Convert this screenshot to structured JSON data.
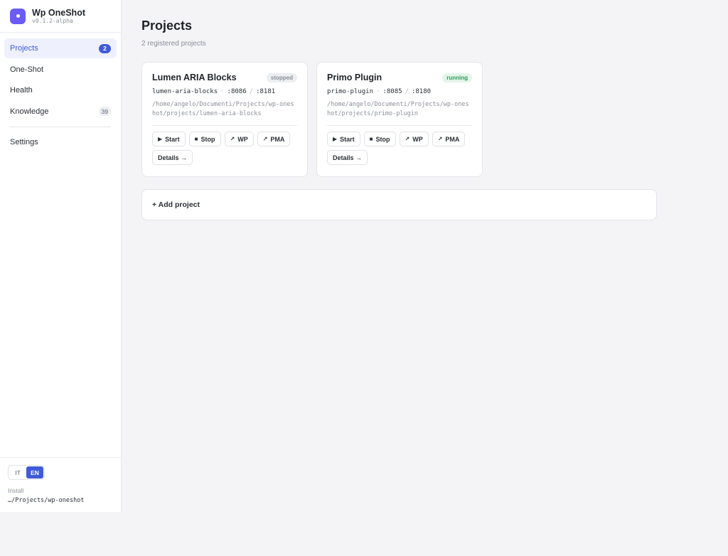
{
  "brand": {
    "name": "Wp OneShot",
    "version": "v0.1.2-alpha"
  },
  "nav": {
    "items": [
      {
        "label": "Projects",
        "badge": "2"
      },
      {
        "label": "One-Shot"
      },
      {
        "label": "Health"
      },
      {
        "label": "Knowledge",
        "badge": "39"
      }
    ],
    "settings_label": "Settings"
  },
  "footer": {
    "lang": [
      "IT",
      "EN"
    ],
    "active_lang": "EN",
    "install_label": "Install",
    "install_path": "…/Projects/wp-oneshot"
  },
  "main": {
    "title": "Projects",
    "subtitle": "2 registered projects",
    "add_project_label": "+ Add project"
  },
  "projects": [
    {
      "name": "Lumen ARIA Blocks",
      "status": "stopped",
      "slug": "lumen-aria-blocks",
      "port_wp": ":8086",
      "port_pma": ":8181",
      "path": "/home/angelo/Documenti/Projects/wp-oneshot/projects/lumen-aria-blocks"
    },
    {
      "name": "Primo Plugin",
      "status": "running",
      "slug": "primo-plugin",
      "port_wp": ":8085",
      "port_pma": ":8180",
      "path": "/home/angelo/Documenti/Projects/wp-oneshot/projects/primo-plugin"
    }
  ],
  "actions": {
    "start": "Start",
    "stop": "Stop",
    "wp": "WP",
    "pma": "PMA",
    "details": "Details →"
  },
  "icons": {
    "start": "play-icon",
    "stop": "stop-icon",
    "wp": "external-link-icon",
    "pma": "external-link-icon"
  },
  "colors": {
    "accent": "#3f5bd8",
    "brand": "#6b5cf5",
    "running": "#2e9b58",
    "stopped": "#8a8f98"
  }
}
